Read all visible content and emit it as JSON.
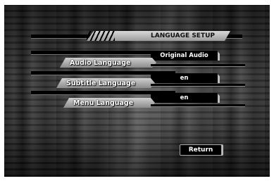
{
  "menu": {
    "title": "LANGUAGE SETUP",
    "rows": [
      {
        "label": "Audio Language",
        "value": "Original Audio"
      },
      {
        "label": "Subtitle Language",
        "value": "en"
      },
      {
        "label": "Menu Language",
        "value": "en"
      }
    ],
    "return_label": "Return"
  }
}
